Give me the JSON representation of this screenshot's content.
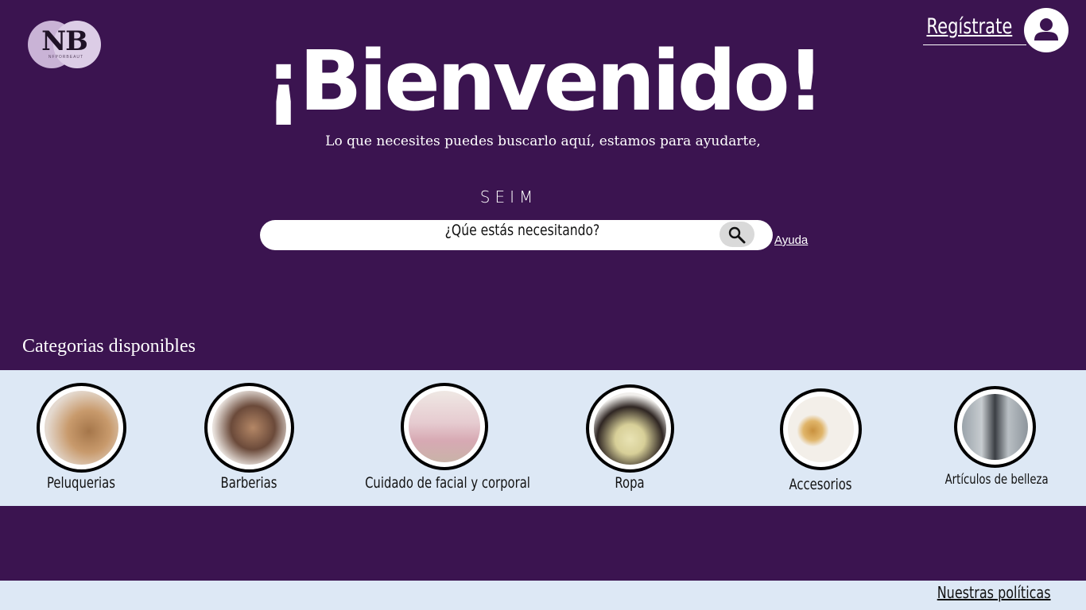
{
  "header": {
    "logo_text": "NB",
    "logo_sub": "NFPORBEAUT",
    "register_label": "Regístrate",
    "avatar_icon": "user-icon"
  },
  "hero": {
    "title": "¡Bienvenido!",
    "subtitle": "Lo que necesites puedes buscarlo aquí, estamos para ayudarte,",
    "brand": "SEIM"
  },
  "search": {
    "placeholder": "¿Qúe estás necesitando?",
    "button_icon": "search-icon",
    "help_label": "Ayuda"
  },
  "categories": {
    "heading": "Categorias disponibles",
    "items": [
      {
        "label": "Peluquerias"
      },
      {
        "label": "Barberias"
      },
      {
        "label": "Cuidado de facial y corporal"
      },
      {
        "label": "Ropa"
      },
      {
        "label": "Accesorios"
      },
      {
        "label": "Artículos de belleza"
      }
    ]
  },
  "footer": {
    "policies_label": "Nuestras políticas"
  },
  "colors": {
    "background": "#3b1450",
    "band": "#dde8f5",
    "text_light": "#ffffff"
  }
}
